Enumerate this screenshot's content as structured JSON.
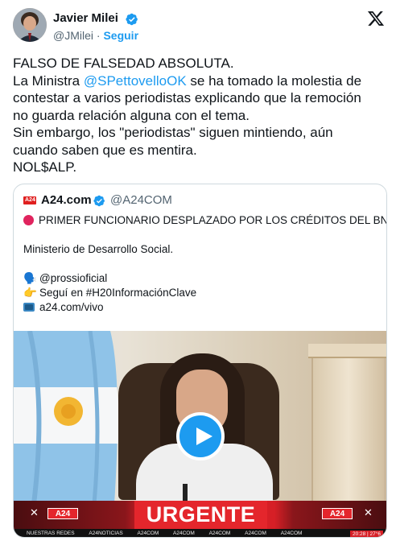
{
  "author": {
    "name": "Javier Milei",
    "handle": "@JMilei",
    "separator": "·",
    "follow_label": "Seguir"
  },
  "tweet": {
    "line_1": "FALSO DE FALSEDAD ABSOLUTA.",
    "line_2_prefix": "La Ministra ",
    "line_2_mention": "@SPettovelloOK",
    "line_2_suffix": " se ha tomado la molestia de",
    "line_3": "contestar a varios periodistas explicando que la remoción",
    "line_4": "no guarda relación alguna con el tema.",
    "line_5": "Sin embargo, los \"periodistas\" siguen mintiendo, aún",
    "line_6": "cuando saben que es mentira.",
    "line_7": "NOL$ALP."
  },
  "quote": {
    "logo_text": "A24",
    "name": "A24.com",
    "handle": "@A24COM",
    "headline": "PRIMER FUNCIONARIO DESPLAZADO POR LOS CRÉDITOS DEL BNA",
    "ministry": "Ministerio de Desarrollo Social.",
    "reporter_emoji": "🗣️",
    "reporter": "@prossioficial",
    "follow_emoji": "👉",
    "follow_text": "Seguí en #H20InformaciónClave",
    "live_link": "a24.com/vivo",
    "media": {
      "banner_text": "URGENTE",
      "channel_left": "A24",
      "channel_right": "A24",
      "ticker": [
        "NUESTRAS REDES",
        "A24NOTICIAS",
        "A24COM",
        "A24COM",
        "A24COM",
        "A24COM",
        "A24COM"
      ],
      "time": "20:28 | 27°6"
    }
  },
  "colors": {
    "link": "#1d9bf0",
    "text": "#0f1419",
    "muted": "#536471",
    "brand_red": "#e4262c"
  },
  "icons": {
    "verified": "verified-badge-icon",
    "x_logo": "x-logo-icon",
    "play": "play-icon"
  }
}
